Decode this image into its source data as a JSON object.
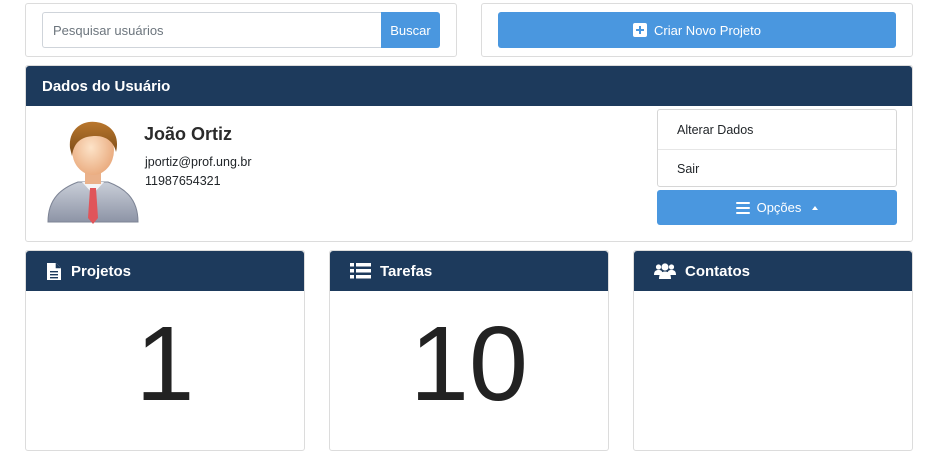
{
  "search": {
    "placeholder": "Pesquisar usuários",
    "button_label": "Buscar"
  },
  "create_project": {
    "label": "Criar Novo Projeto",
    "icon": "plus-square-icon"
  },
  "user_panel": {
    "title": "Dados do Usuário",
    "name": "João Ortiz",
    "email": "jportiz@prof.ung.br",
    "phone": "11987654321",
    "menu_items": [
      "Alterar Dados",
      "Sair"
    ],
    "options_label": "Opções"
  },
  "cards": {
    "projetos": {
      "title": "Projetos",
      "value": "1",
      "icon": "file-icon"
    },
    "tarefas": {
      "title": "Tarefas",
      "value": "10",
      "icon": "list-icon"
    },
    "contatos": {
      "title": "Contatos",
      "value": "",
      "icon": "users-icon"
    }
  },
  "colors": {
    "header": "#1d3a5c",
    "accent": "#4a97df"
  }
}
